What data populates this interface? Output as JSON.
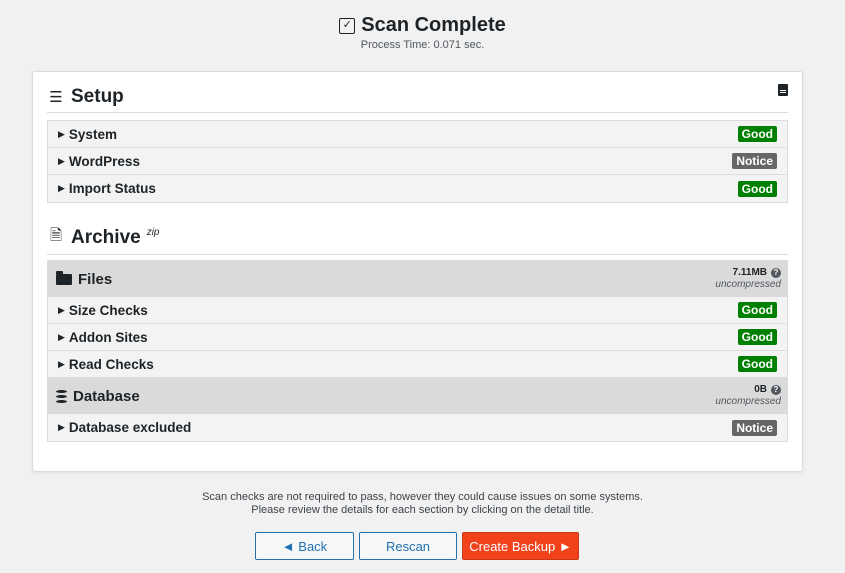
{
  "header": {
    "title": "Scan Complete",
    "process_time": "Process Time: 0.071 sec."
  },
  "setup": {
    "title": "Setup",
    "rows": [
      {
        "label": "System",
        "status": "Good"
      },
      {
        "label": "WordPress",
        "status": "Notice"
      },
      {
        "label": "Import Status",
        "status": "Good"
      }
    ]
  },
  "archive": {
    "title": "Archive",
    "format": "zip",
    "files": {
      "title": "Files",
      "size": "7.11MB",
      "size_note": "uncompressed",
      "rows": [
        {
          "label": "Size Checks",
          "status": "Good"
        },
        {
          "label": "Addon Sites",
          "status": "Good"
        },
        {
          "label": "Read Checks",
          "status": "Good"
        }
      ]
    },
    "database": {
      "title": "Database",
      "size": "0B",
      "size_note": "uncompressed",
      "rows": [
        {
          "label": "Database excluded",
          "status": "Notice"
        }
      ]
    }
  },
  "footer_note": {
    "line1": "Scan checks are not required to pass, however they could cause issues on some systems.",
    "line2": "Please review the details for each section by clicking on the detail title."
  },
  "buttons": {
    "back": "◄ Back",
    "rescan": "Rescan",
    "create": "Create Backup ►"
  },
  "colors": {
    "good": "#008000",
    "notice": "#666666",
    "primary": "#2271b1",
    "create": "#f1421c"
  }
}
